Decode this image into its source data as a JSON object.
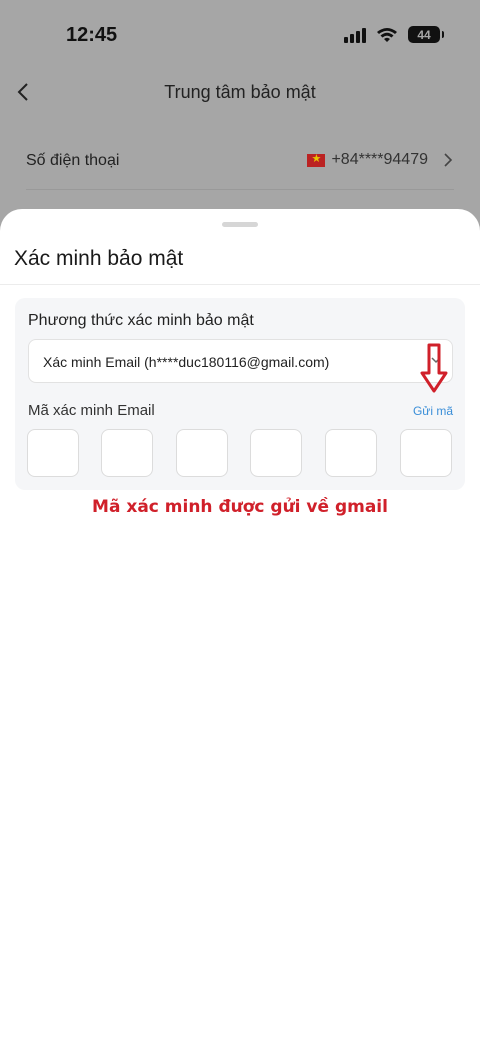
{
  "status_bar": {
    "time": "12:45",
    "battery": "44"
  },
  "nav": {
    "title": "Trung tâm bảo mật"
  },
  "phone_row": {
    "label": "Số điện thoại",
    "value": "+84****94479"
  },
  "sheet": {
    "title": "Xác minh bảo mật",
    "method_label": "Phương thức xác minh bảo mật",
    "method_value": "Xác minh Email (h****duc180116@gmail.com)",
    "code_label": "Mã xác minh Email",
    "send_code_label": "Gửi mã",
    "code_digits": [
      "",
      "",
      "",
      "",
      "",
      ""
    ],
    "annotation": "Mã xác minh được gửi về gmail"
  },
  "colors": {
    "annotation": "#d0202a",
    "link": "#3a8ed8",
    "overlay": "#a6a6a6"
  },
  "icons": [
    "back-arrow-icon",
    "chevron-right-icon",
    "vietnam-flag-icon",
    "caret-down-icon",
    "red-down-arrow-icon",
    "wifi-icon",
    "signal-icon",
    "battery-icon"
  ]
}
